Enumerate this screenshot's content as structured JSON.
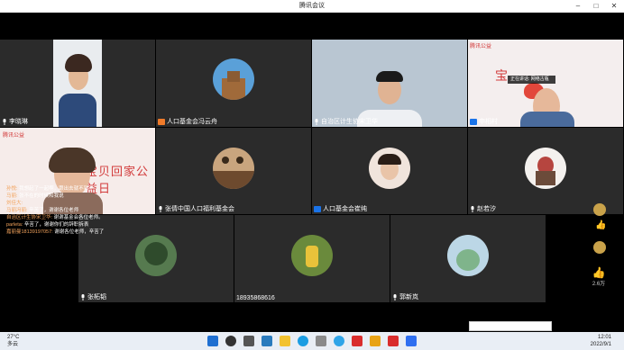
{
  "window": {
    "title": "腾讯会议"
  },
  "participants": [
    {
      "name": "李晓琳"
    },
    {
      "name": "人口基金会冯云舟"
    },
    {
      "name": "自治区计生协宋卫华"
    },
    {
      "name": "申相村"
    },
    {
      "name": "冯 ·"
    },
    {
      "name": "张倩中国人口福利基金会"
    },
    {
      "name": "人口基金会崔纯"
    },
    {
      "name": "赵若汐"
    },
    {
      "name": "张柘韬"
    },
    {
      "name": "18935868616"
    },
    {
      "name": "郭新岚"
    }
  ],
  "speaking_tag": "正在讲话: 网络古瓶",
  "brand": {
    "tencent": "腾讯公益"
  },
  "banner_text": "宝贝回家公益日",
  "chat": [
    {
      "from": "孙悦:",
      "text": "我想起了一起啊，跟出去就不到了"
    },
    {
      "from": "马丽:",
      "text": "张不在的时候和我说"
    },
    {
      "from": "刘佳大:",
      "text": ""
    },
    {
      "from": "马丽冯丽:",
      "text": "辛苦了，谢谢各位老师"
    },
    {
      "from": "自治区计生协宋卫华:",
      "text": "谢谢基金会各位老师。"
    },
    {
      "from": "parleta:",
      "text": "辛苦了，谢谢你们的辞职拆表"
    },
    {
      "from": "嘉丽曼18139197057:",
      "text": "谢谢各位老师，辛苦了"
    }
  ],
  "right_tools": {
    "like_count": "2.6万"
  },
  "taskbar": {
    "temp": "27°C",
    "weather": "多云",
    "time": "12:01",
    "date": "2022/9/1"
  },
  "colors": {
    "tile_bg": "#2b2b2b",
    "accent": "#f3a35c",
    "taskbar": "#e9eef5"
  }
}
